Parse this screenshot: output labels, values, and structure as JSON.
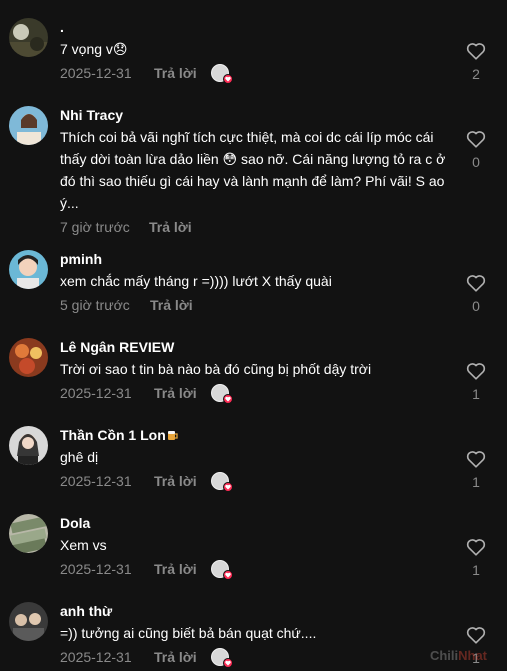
{
  "comments": [
    {
      "name": ".",
      "text": "7 vọng v😞",
      "date": "2025-12-31",
      "reply": "Trả lời",
      "likes": "2",
      "creator_liked": true,
      "avatar": "avatar-dark-landscape"
    },
    {
      "name": "Nhi Tracy",
      "text": "Thích coi bả vãi nghĩ tích cực thiệt, mà coi dc cái líp móc cái thấy dời toàn lừa dảo liền 😳 sao nỡ. Cái năng lượng tỏ ra c ở đó thì sao thiếu gì cái hay và lành mạnh để làm? Phí vãi! S ao ý...",
      "date": "7 giờ trước",
      "reply": "Trả lời",
      "likes": "0",
      "creator_liked": false,
      "avatar": "avatar-girl-photo"
    },
    {
      "name": "pminh",
      "text": "xem chắc mấy tháng r =)))) lướt X thấy quài",
      "date": "5 giờ trước",
      "reply": "Trả lời",
      "likes": "0",
      "creator_liked": false,
      "avatar": "avatar-selfie"
    },
    {
      "name": "Lê Ngân REVIEW",
      "text": "Trời ơi sao t tin bà nào bà đó cũng bị phốt dậy trời",
      "date": "2025-12-31",
      "reply": "Trả lời",
      "likes": "1",
      "creator_liked": true,
      "avatar": "avatar-food"
    },
    {
      "name": "Thần Cồn 1 Lon",
      "name_suffix_icon": "beer-mug-icon",
      "text": "ghê dị",
      "date": "2025-12-31",
      "reply": "Trả lời",
      "likes": "1",
      "creator_liked": true,
      "avatar": "avatar-portrait"
    },
    {
      "name": "Dola",
      "text": "Xem vs",
      "date": "2025-12-31",
      "reply": "Trả lời",
      "likes": "1",
      "creator_liked": true,
      "avatar": "avatar-money"
    },
    {
      "name": "anh thừ",
      "text": "=)) tưởng ai cũng biết bả bán quạt chứ....",
      "date": "2025-12-31",
      "reply": "Trả lời",
      "likes": "1",
      "creator_liked": true,
      "avatar": "avatar-group"
    }
  ],
  "watermark": {
    "part1": "Chili",
    "part2": "Nhat"
  },
  "colors": {
    "background": "#121212",
    "secondary_text": "#8a8a8a",
    "like_badge": "#fe2c55"
  }
}
